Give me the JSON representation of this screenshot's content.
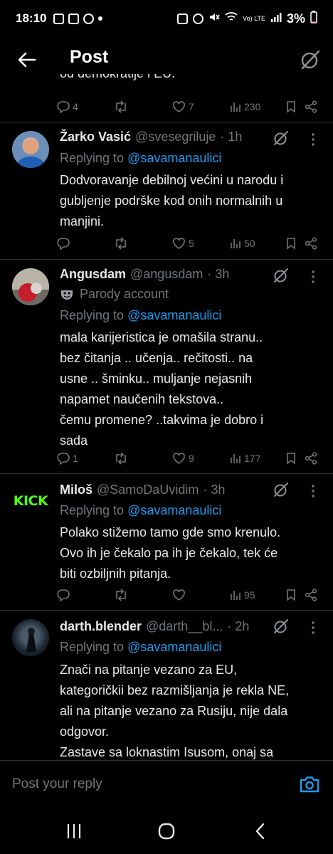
{
  "status_bar": {
    "time": "18:10",
    "battery": "3%",
    "network_label": "Vo) LTE"
  },
  "header": {
    "title": "Post"
  },
  "previous_tweet": {
    "clipped_text": "od demokratije i EU.",
    "actions": {
      "replies": "4",
      "reposts": "",
      "likes": "7",
      "views": "230"
    }
  },
  "tweets": [
    {
      "name": "Žarko Vasić",
      "handle": "@svesegriluje",
      "time": "· 1h",
      "replying_prefix": "Replying to ",
      "replying_to": "@savamanaulici",
      "text": [
        "Dodvoravanje debilnoj većini u narodu i",
        "gubljenje podrške kod onih normalnih u",
        "manjini."
      ],
      "actions": {
        "replies": "",
        "reposts": "",
        "likes": "5",
        "views": "50"
      }
    },
    {
      "name": "Angusdam",
      "handle": "@angusdam",
      "time": "· 3h",
      "badge": "Parody account",
      "replying_prefix": "Replying to ",
      "replying_to": "@savamanaulici",
      "text": [
        "mala karijeristica je omašila stranu..",
        "bez čitanja .. učenja.. rečitosti.. na",
        "usne .. šminku.. muljanje nejasnih",
        "napamet naučenih tekstova..",
        "čemu promene? ..takvima je dobro i",
        "sada"
      ],
      "actions": {
        "replies": "1",
        "reposts": "",
        "likes": "9",
        "views": "177"
      }
    },
    {
      "name": "Miloš",
      "handle": "@SamoDaUvidim",
      "time": "· 3h",
      "avatar_text": "KICK",
      "replying_prefix": "Replying to ",
      "replying_to": "@savamanaulici",
      "text": [
        "Polako stižemo tamo gde smo krenulo.",
        "Ovo ih je čekalo pa ih je čekalo, tek će",
        "biti ozbiljnih pitanja."
      ],
      "actions": {
        "replies": "",
        "reposts": "",
        "likes": "",
        "views": "95"
      }
    },
    {
      "name": "darth.blender",
      "handle": "@darth__bl...",
      "time": "· 2h",
      "replying_prefix": "Replying to ",
      "replying_to": "@savamanaulici",
      "text": [
        "Znači na pitanje vezano za EU,",
        "kategoričkii bez razmišljanja je rekla NE,",
        "ali na pitanje vezano za Rusiju, nije dala",
        "odgovor.",
        "Zastave sa loknastim Isusom, onaj sa"
      ]
    }
  ],
  "composer": {
    "placeholder": "Post your reply"
  },
  "colors": {
    "background": "#000000",
    "text": "#e7e9ea",
    "muted": "#71767b",
    "accent": "#1d9bf0",
    "divider": "#2f3336",
    "kick_green": "#53fc18"
  },
  "icons": {
    "back": "arrow-left-icon",
    "grok": "grok-icon",
    "more": "more-vertical-icon",
    "reply": "reply-icon",
    "repost": "repost-icon",
    "like": "heart-icon",
    "views": "views-icon",
    "bookmark": "bookmark-icon",
    "share": "share-icon",
    "camera": "camera-icon",
    "parody": "mask-icon"
  }
}
